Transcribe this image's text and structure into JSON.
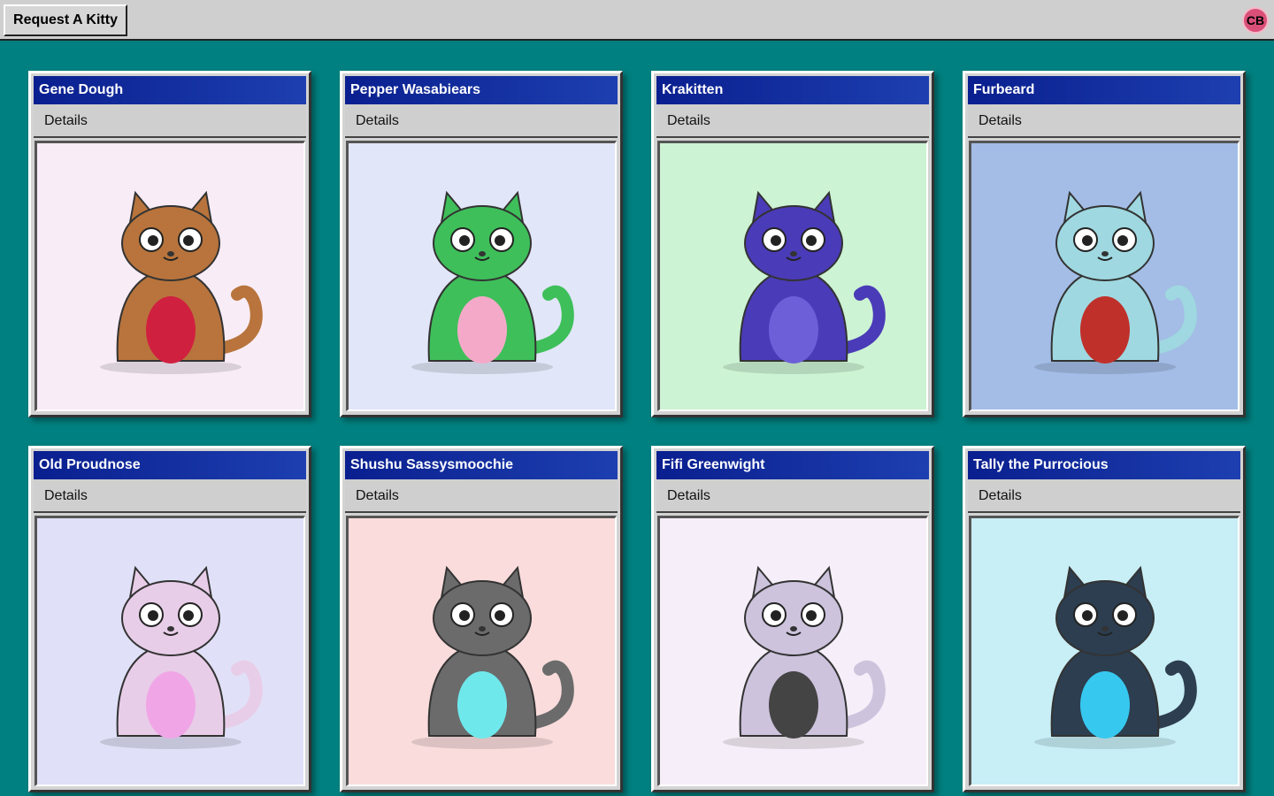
{
  "toolbar": {
    "request_label": "Request A Kitty",
    "avatar_initials": "CB",
    "avatar_color": "#d94f78"
  },
  "cards": [
    {
      "name": "Gene Dough",
      "details_label": "Details",
      "bg": "#f8ecf6",
      "body": "#b8743c",
      "accent": "#d02040"
    },
    {
      "name": "Pepper Wasabiears",
      "details_label": "Details",
      "bg": "#e1e6f8",
      "body": "#3ebf5a",
      "accent": "#f5a9c8"
    },
    {
      "name": "Krakitten",
      "details_label": "Details",
      "bg": "#ccf3d3",
      "body": "#4a3bb8",
      "accent": "#6d5fd8"
    },
    {
      "name": "Furbeard",
      "details_label": "Details",
      "bg": "#a3bde6",
      "body": "#9fd8e0",
      "accent": "#c0302a"
    },
    {
      "name": "Old Proudnose",
      "details_label": "Details",
      "bg": "#e0e0f8",
      "body": "#e8cde8",
      "accent": "#f0a6e6"
    },
    {
      "name": "Shushu Sassysmoochie",
      "details_label": "Details",
      "bg": "#fadcdc",
      "body": "#6b6b6b",
      "accent": "#6fe8ec"
    },
    {
      "name": "Fifi Greenwight",
      "details_label": "Details",
      "bg": "#f6eef8",
      "body": "#cdc3dd",
      "accent": "#444444"
    },
    {
      "name": "Tally the Purrocious",
      "details_label": "Details",
      "bg": "#c8eef6",
      "body": "#2c3e50",
      "accent": "#37c8f0"
    }
  ]
}
